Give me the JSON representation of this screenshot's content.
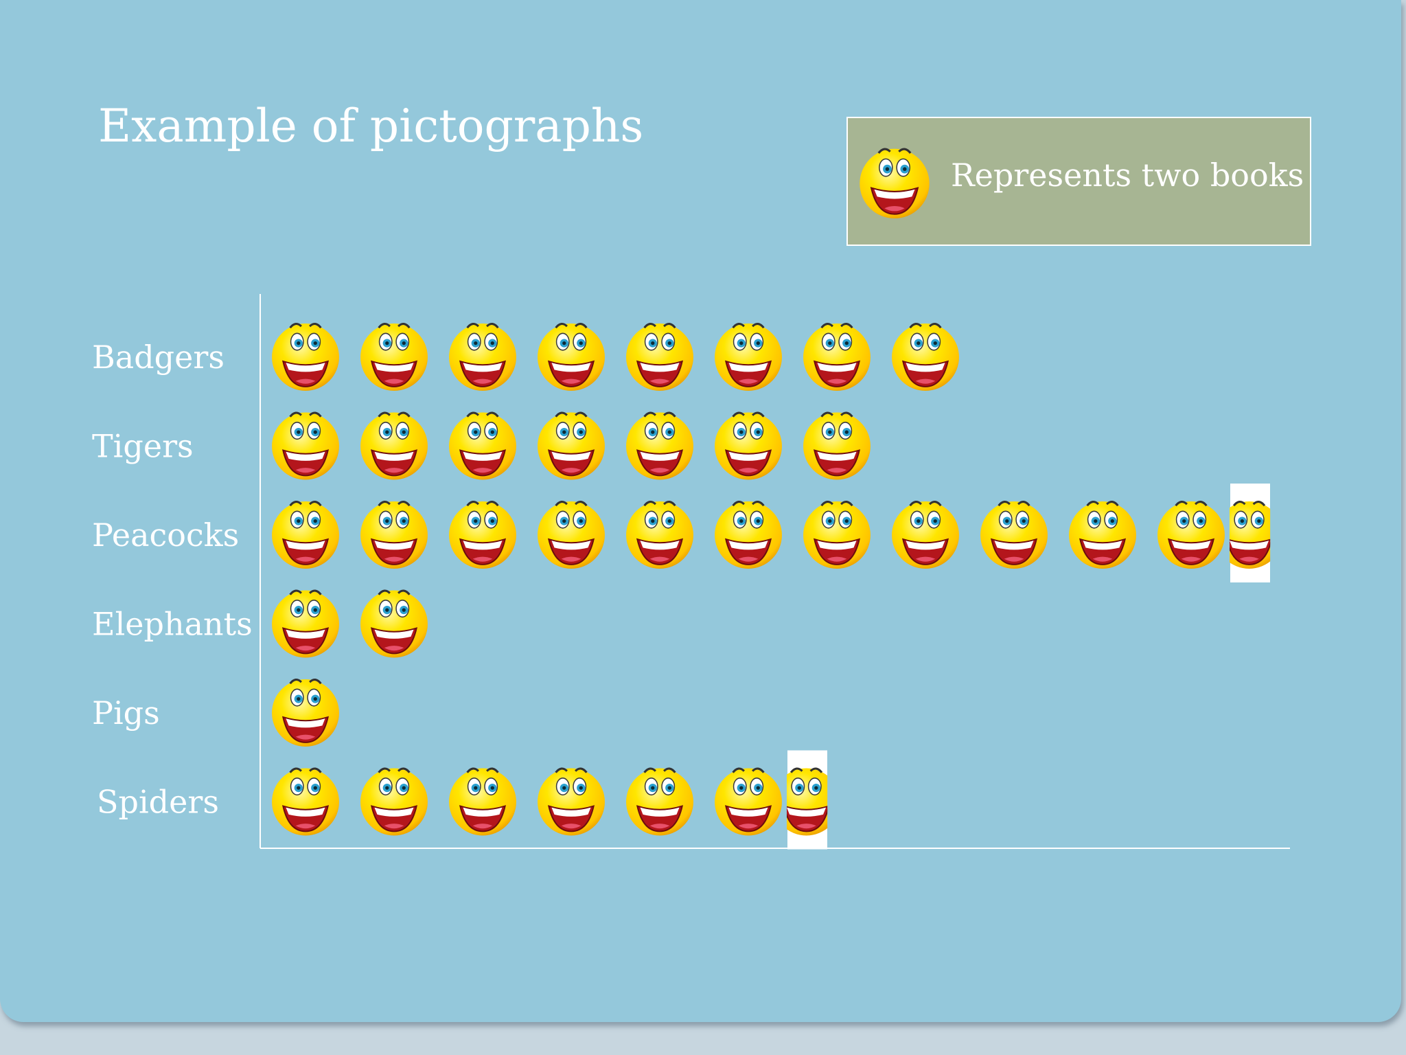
{
  "title": "Example of pictographs",
  "legend": {
    "icon": "smiley-face-icon",
    "text": "Represents two books"
  },
  "colors": {
    "background": "#94c8db",
    "legend_box": "#a7b593",
    "text": "#ffffff",
    "face": "#ffd800",
    "face_edge": "#e89a00"
  },
  "chart_data": {
    "type": "pictograph",
    "orientation": "horizontal",
    "icon": "smiley-face-icon",
    "units_per_icon": 2,
    "categories": [
      "Badgers",
      "Tigers",
      "Peacocks",
      "Elephants",
      "Pigs",
      "Spiders"
    ],
    "icons": [
      8,
      7,
      11.5,
      2,
      1,
      6.5
    ],
    "values": [
      16,
      14,
      23,
      4,
      2,
      13
    ]
  }
}
